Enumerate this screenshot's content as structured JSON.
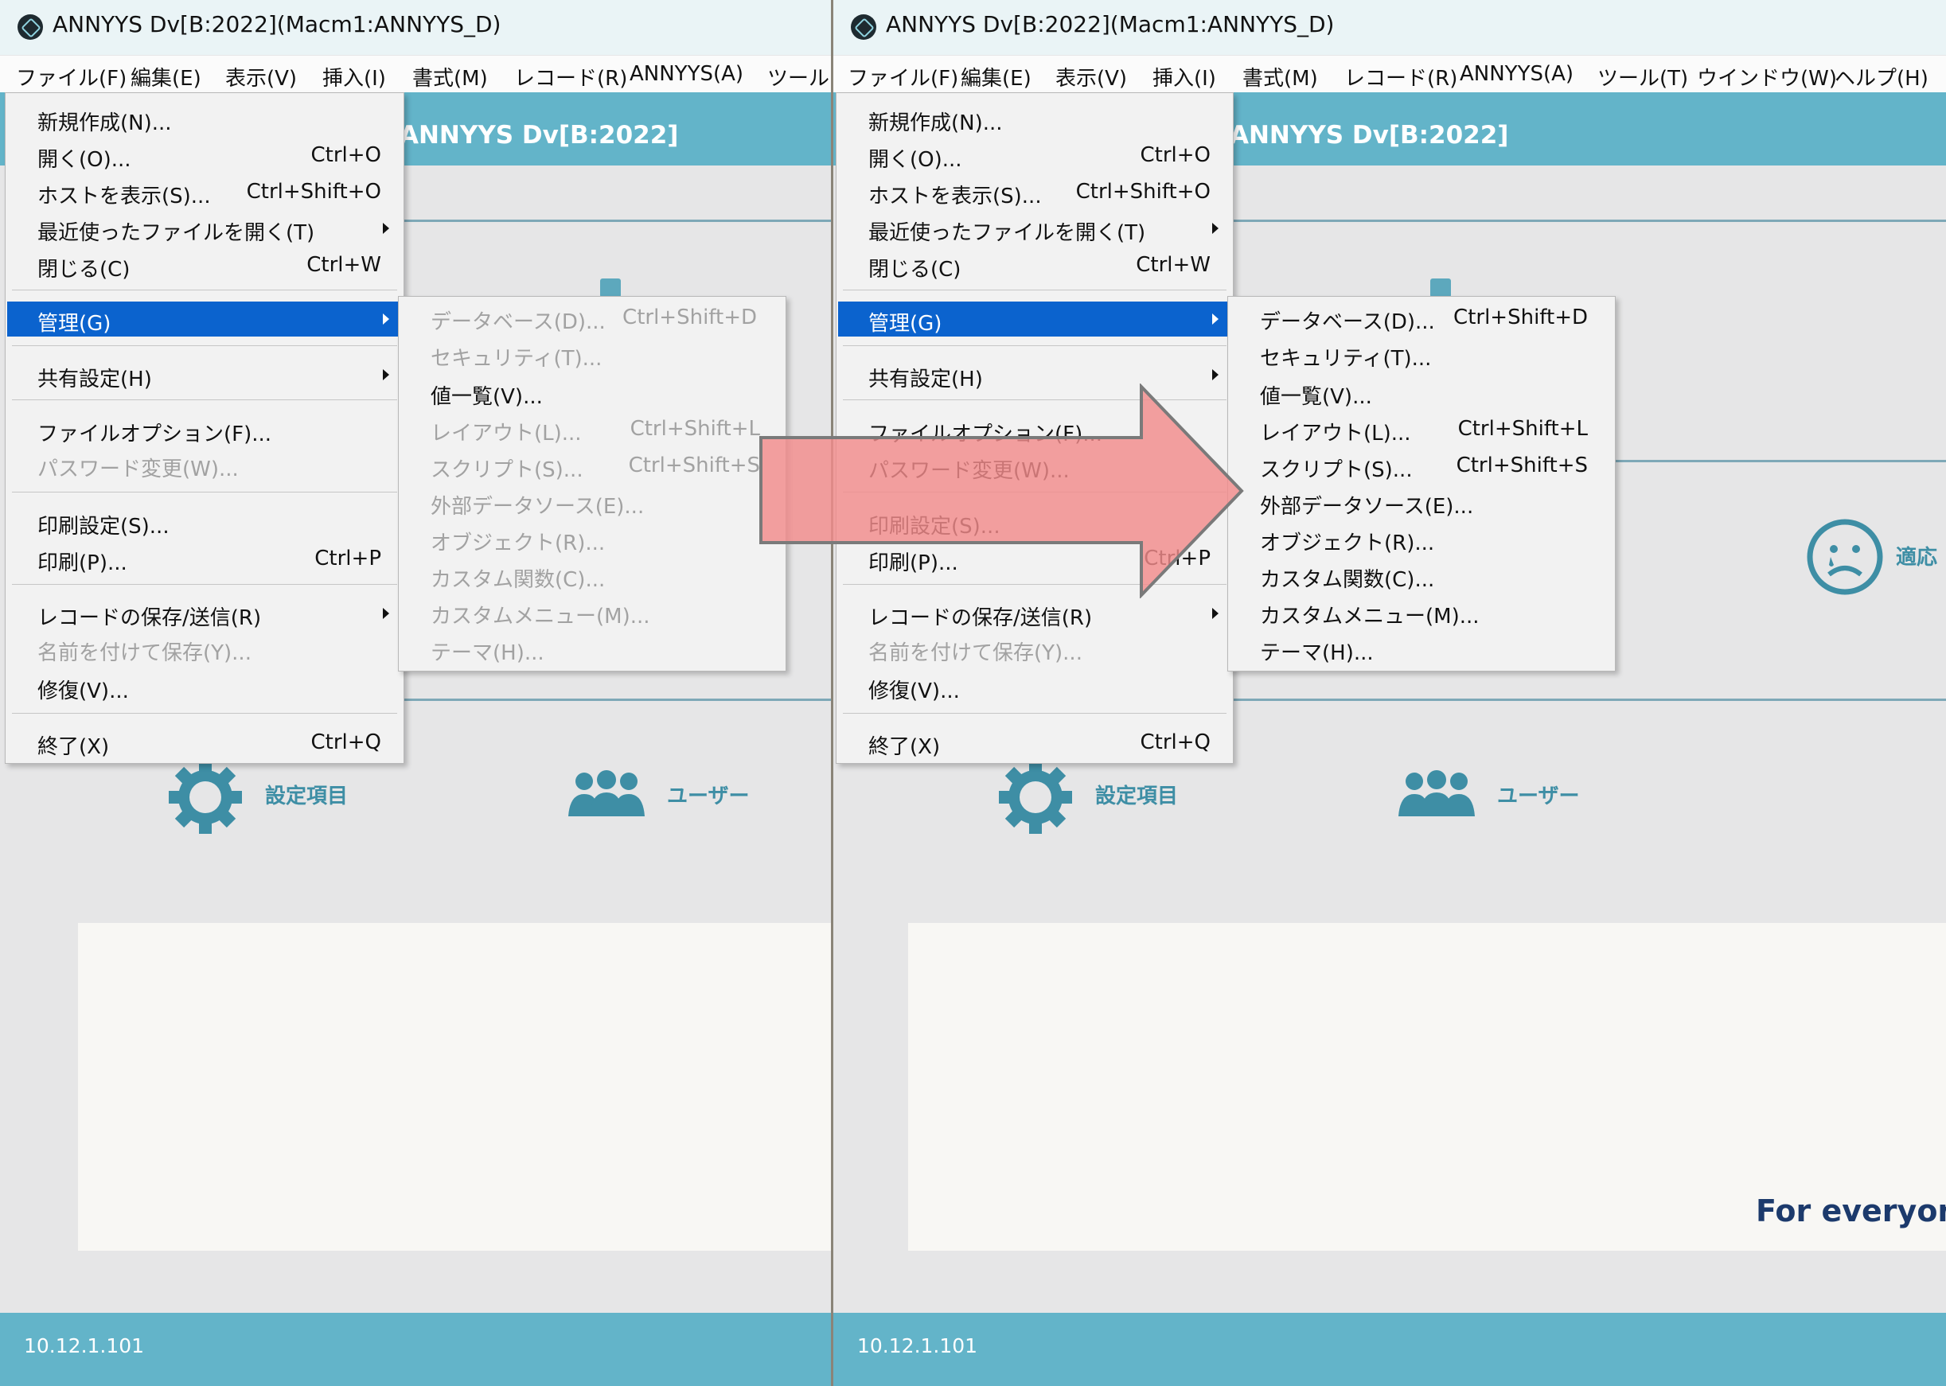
{
  "window": {
    "title": "ANNYYS Dv[B:2022](Macm1:ANNYYS_D)",
    "banner_title": "ANNYYS Dv[B:2022]",
    "settings_label": "設定項目",
    "users_label": "ユーザー",
    "ip": "10.12.1.101",
    "sad_label": "適応",
    "tagline": "For everyone"
  },
  "menubar": [
    "ファイル(F)",
    "編集(E)",
    "表示(V)",
    "挿入(I)",
    "書式(M)",
    "レコード(R)",
    "ANNYYS(A)",
    "ツール(T)",
    "ウインドウ(W)",
    "ヘルプ(H)"
  ],
  "menubar_left_last": "ツール(T",
  "file_menu": [
    {
      "label": "新規作成(N)...",
      "shortcut": ""
    },
    {
      "label": "開く(O)...",
      "shortcut": "Ctrl+O"
    },
    {
      "label": "ホストを表示(S)...",
      "shortcut": "Ctrl+Shift+O"
    },
    {
      "label": "最近使ったファイルを開く(T)",
      "shortcut": ""
    },
    {
      "label": "閉じる(C)",
      "shortcut": "Ctrl+W"
    },
    {
      "label": "管理(G)",
      "shortcut": ""
    },
    {
      "label": "共有設定(H)",
      "shortcut": ""
    },
    {
      "label": "ファイルオプション(F)...",
      "shortcut": ""
    },
    {
      "label": "パスワード変更(W)...",
      "shortcut": ""
    },
    {
      "label": "印刷設定(S)...",
      "shortcut": ""
    },
    {
      "label": "印刷(P)...",
      "shortcut": "Ctrl+P"
    },
    {
      "label": "レコードの保存/送信(R)",
      "shortcut": ""
    },
    {
      "label": "名前を付けて保存(Y)...",
      "shortcut": ""
    },
    {
      "label": "修復(V)...",
      "shortcut": ""
    },
    {
      "label": "終了(X)",
      "shortcut": "Ctrl+Q"
    }
  ],
  "manage_submenu": [
    {
      "label": "データベース(D)...",
      "shortcut": "Ctrl+Shift+D"
    },
    {
      "label": "セキュリティ(T)...",
      "shortcut": ""
    },
    {
      "label": "値一覧(V)...",
      "shortcut": ""
    },
    {
      "label": "レイアウト(L)...",
      "shortcut": "Ctrl+Shift+L"
    },
    {
      "label": "スクリプト(S)...",
      "shortcut": "Ctrl+Shift+S"
    },
    {
      "label": "外部データソース(E)...",
      "shortcut": ""
    },
    {
      "label": "オブジェクト(R)...",
      "shortcut": ""
    },
    {
      "label": "カスタム関数(C)...",
      "shortcut": ""
    },
    {
      "label": "カスタムメニュー(M)...",
      "shortcut": ""
    },
    {
      "label": "テーマ(H)...",
      "shortcut": ""
    }
  ],
  "colors": {
    "banner": "#63b4c9",
    "highlight": "#0b63ce",
    "disabled_text": "#a2a2a2",
    "arrow_fill": "#f28b8b",
    "arrow_stroke": "#7a7a7a"
  }
}
